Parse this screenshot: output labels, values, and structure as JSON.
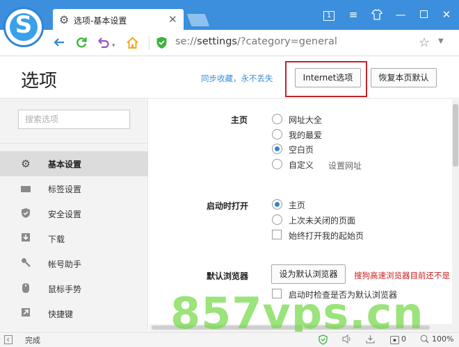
{
  "browser": {
    "tab_title": "选项-基本设置",
    "url_scheme": "se://",
    "url_host": "settings",
    "url_rest": "/?category=general"
  },
  "header": {
    "title": "选项",
    "sync_link": "同步收藏，永不丢失",
    "internet_button": "Internet选项",
    "restore_button": "恢复本页默认"
  },
  "sidebar": {
    "search_placeholder": "搜索选项",
    "items": [
      {
        "label": "基本设置",
        "icon": "gear-icon",
        "active": true
      },
      {
        "label": "标签设置",
        "icon": "tab-icon"
      },
      {
        "label": "安全设置",
        "icon": "shield-icon"
      },
      {
        "label": "下载",
        "icon": "download-icon"
      },
      {
        "label": "帐号助手",
        "icon": "key-icon"
      },
      {
        "label": "鼠标手势",
        "icon": "mouse-icon"
      },
      {
        "label": "快捷键",
        "icon": "shortcut-icon"
      }
    ]
  },
  "homepage": {
    "label": "主页",
    "options": [
      "网址大全",
      "我的最爱",
      "空白页",
      "自定义"
    ],
    "selected": "空白页",
    "set_url_link": "设置网址"
  },
  "startup": {
    "label": "启动时打开",
    "options": [
      "主页",
      "上次未关闭的页面"
    ],
    "selected": "主页",
    "checkbox": "始终打开我的起始页"
  },
  "default_browser": {
    "label": "默认浏览器",
    "button": "设为默认浏览器",
    "warning": "搜狗高速浏览器目前还不是",
    "checkbox": "启动时检查是否为默认浏览器"
  },
  "statusbar": {
    "status": "完成",
    "count": "0",
    "zoom": "100%"
  },
  "watermark": "857vps.cn",
  "colors": {
    "titlebar": "#3b8fdc",
    "accent": "#2f86d6",
    "highlight_box": "#c0232a",
    "warning": "#c81e1e",
    "watermark": "#74d848"
  }
}
